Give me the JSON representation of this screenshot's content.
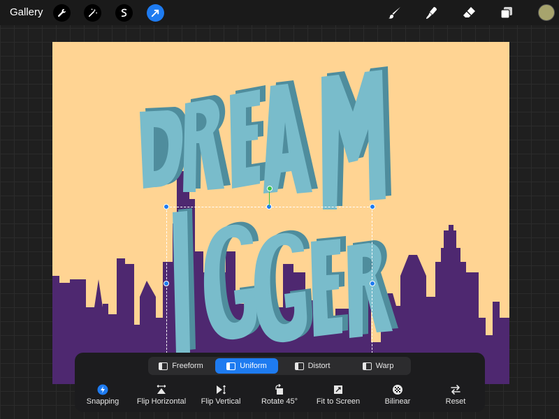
{
  "topbar": {
    "gallery_label": "Gallery",
    "left_tools": [
      "wrench-icon",
      "magic-wand-icon",
      "selection-icon",
      "transform-arrow-icon"
    ],
    "active_tool": "transform-arrow-icon",
    "right_tools": [
      "brush-icon",
      "smudge-icon",
      "eraser-icon",
      "layers-icon"
    ],
    "current_color": "#a7a46d"
  },
  "canvas": {
    "background_color": "#ffd493",
    "skyline_color": "#4e2870",
    "letter_color": "#79bccb",
    "letter_shadow_color": "#4f8d9d",
    "artwork_text_top": "DREAM",
    "artwork_text_bottom": "IGGER"
  },
  "transform": {
    "modes": [
      {
        "label": "Freeform",
        "active": false
      },
      {
        "label": "Uniform",
        "active": true
      },
      {
        "label": "Distort",
        "active": false
      },
      {
        "label": "Warp",
        "active": false
      }
    ],
    "actions": [
      {
        "label": "Snapping",
        "icon": "snapping-icon"
      },
      {
        "label": "Flip Horizontal",
        "icon": "flip-horizontal-icon"
      },
      {
        "label": "Flip Vertical",
        "icon": "flip-vertical-icon"
      },
      {
        "label": "Rotate 45°",
        "icon": "rotate-icon"
      },
      {
        "label": "Fit to Screen",
        "icon": "fit-to-screen-icon"
      },
      {
        "label": "Bilinear",
        "icon": "bilinear-icon"
      },
      {
        "label": "Reset",
        "icon": "reset-icon"
      }
    ]
  },
  "colors": {
    "accent": "#1e7bf0",
    "rotation_handle": "#38c24a"
  }
}
